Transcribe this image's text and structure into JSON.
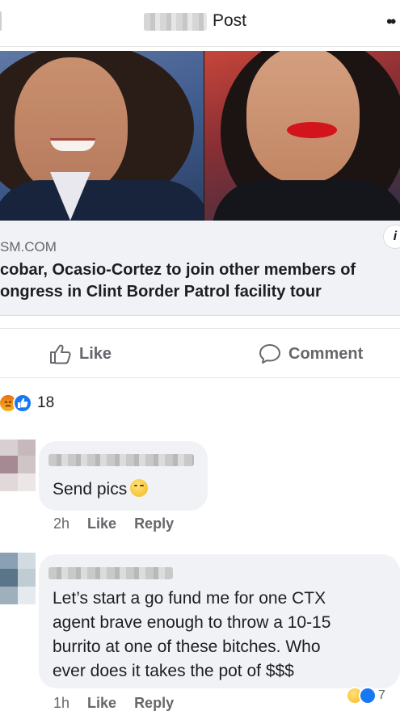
{
  "header": {
    "title": "Post",
    "more_icon": "more-dots-icon"
  },
  "link_preview": {
    "domain": "SM.COM",
    "headline_line1": "cobar, Ocasio-Cortez to join other members of",
    "headline_line2": "ongress in Clint Border Patrol facility tour",
    "info_icon": "i"
  },
  "actions": {
    "like_label": "Like",
    "comment_label": "Comment"
  },
  "reactions": {
    "icons": [
      "angry-reaction-icon",
      "like-reaction-icon"
    ],
    "count": "18"
  },
  "comments": [
    {
      "text": "Send pics",
      "emoji": "smirk-emoji-icon",
      "time": "2h",
      "like_label": "Like",
      "reply_label": "Reply"
    },
    {
      "line1": "Let’s start a go fund me for one CTX",
      "line2": "agent brave enough to throw a 10-15",
      "line3": "burrito at one of these bitches. Who",
      "line4": "ever does it takes the pot of $$$",
      "time": "1h",
      "like_label": "Like",
      "reply_label": "Reply",
      "reaction_count": "7"
    }
  ],
  "colors": {
    "facebook_blue": "#1877f2",
    "bubble_gray": "#f0f2f5",
    "meta_gray": "#65676b"
  }
}
